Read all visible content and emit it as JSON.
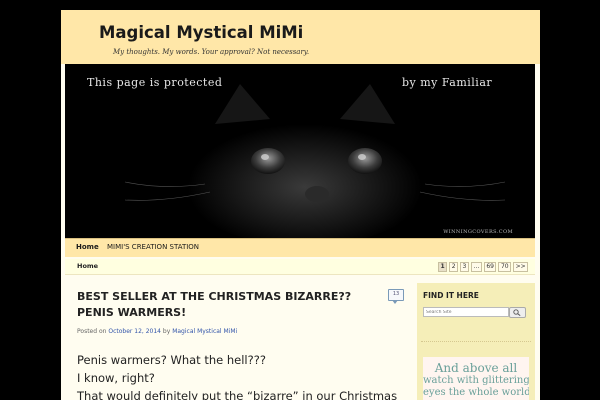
{
  "site": {
    "title": "Magical Mystical MiMi",
    "description": "My thoughts. My words. Your approval? Not necessary."
  },
  "banner": {
    "text_left": "This page is protected",
    "text_right": "by my Familiar",
    "credit": "WINNINGCOVERS.COM"
  },
  "nav": {
    "items": [
      {
        "label": "Home"
      },
      {
        "label": "MIMI'S CREATION STATION"
      }
    ]
  },
  "breadcrumb": {
    "home": "Home"
  },
  "pagination": {
    "pages": [
      "1",
      "2",
      "3",
      "…",
      "69",
      "70",
      ">>"
    ],
    "current": "1"
  },
  "post": {
    "title": "BEST SELLER AT THE CHRISTMAS BIZARRE?? PENIS WARMERS!",
    "comment_count": "13",
    "meta_prefix": "Posted on",
    "date": "October 12, 2014",
    "meta_by": "by",
    "author": "Magical Mystical MiMi",
    "body": [
      "Penis warmers? What the hell???",
      "I know, right?",
      "That would definitely put the “bizarre” in our Christmas"
    ]
  },
  "sidebar": {
    "widget_title": "FIND IT HERE",
    "search_placeholder": "Search Site",
    "promo_lines": [
      "And above all",
      "watch with glittering",
      "eyes the whole world"
    ]
  }
}
